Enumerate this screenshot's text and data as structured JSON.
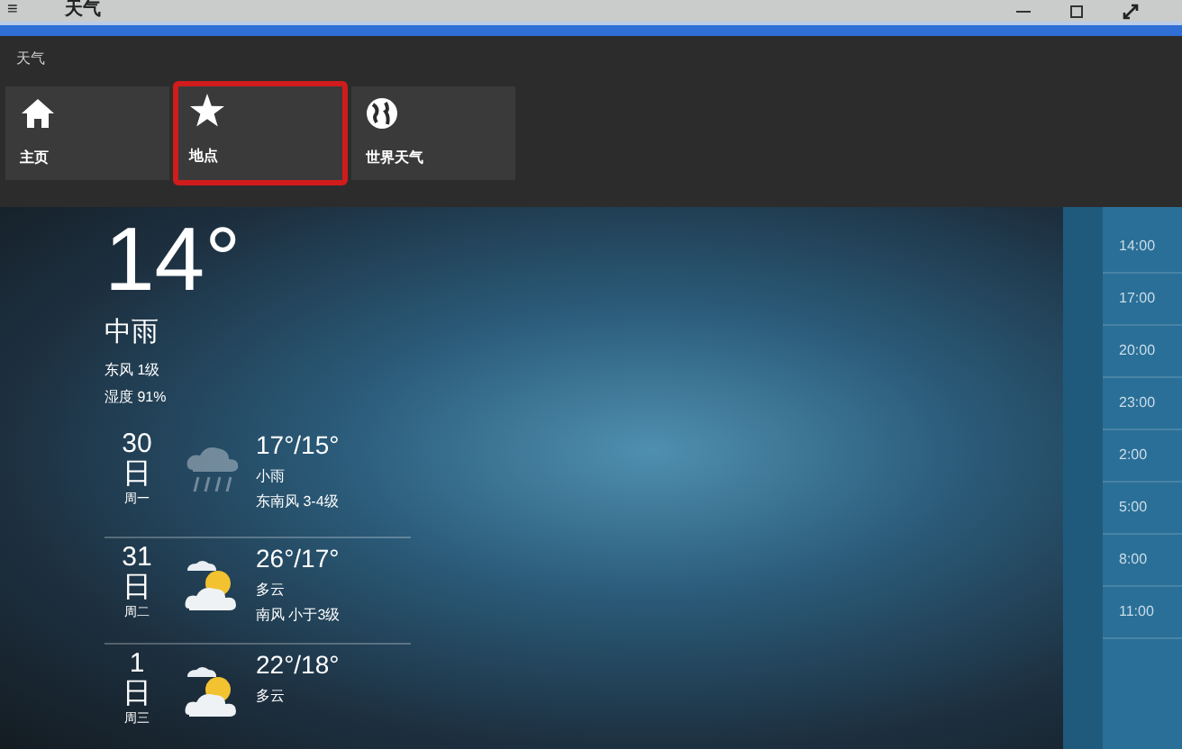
{
  "window": {
    "menu_glyph": "≡",
    "title": "天气"
  },
  "app_bar": {
    "title": "天气",
    "nav": [
      {
        "kind": "home",
        "label": "主页",
        "selected": false
      },
      {
        "kind": "star",
        "label": "地点",
        "selected": true
      },
      {
        "kind": "globe",
        "label": "世界天气",
        "selected": false
      }
    ]
  },
  "current": {
    "temperature": "14°",
    "condition": "中雨",
    "wind": "东风 1级",
    "humidity": "湿度 91%"
  },
  "forecast": [
    {
      "kind": "rain",
      "day": "30",
      "unit": "日",
      "weekday": "周一",
      "temps": "17°/15°",
      "condition": "小雨",
      "wind": "东南风 3-4级"
    },
    {
      "kind": "cloudy",
      "day": "31",
      "unit": "日",
      "weekday": "周二",
      "temps": "26°/17°",
      "condition": "多云",
      "wind": "南风 小于3级"
    },
    {
      "kind": "cloudy",
      "day": "1",
      "unit": "日",
      "weekday": "周三",
      "temps": "22°/18°",
      "condition": "多云"
    }
  ],
  "hourly": [
    "14:00",
    "17:00",
    "20:00",
    "23:00",
    "2:00",
    "5:00",
    "8:00",
    "11:00"
  ]
}
